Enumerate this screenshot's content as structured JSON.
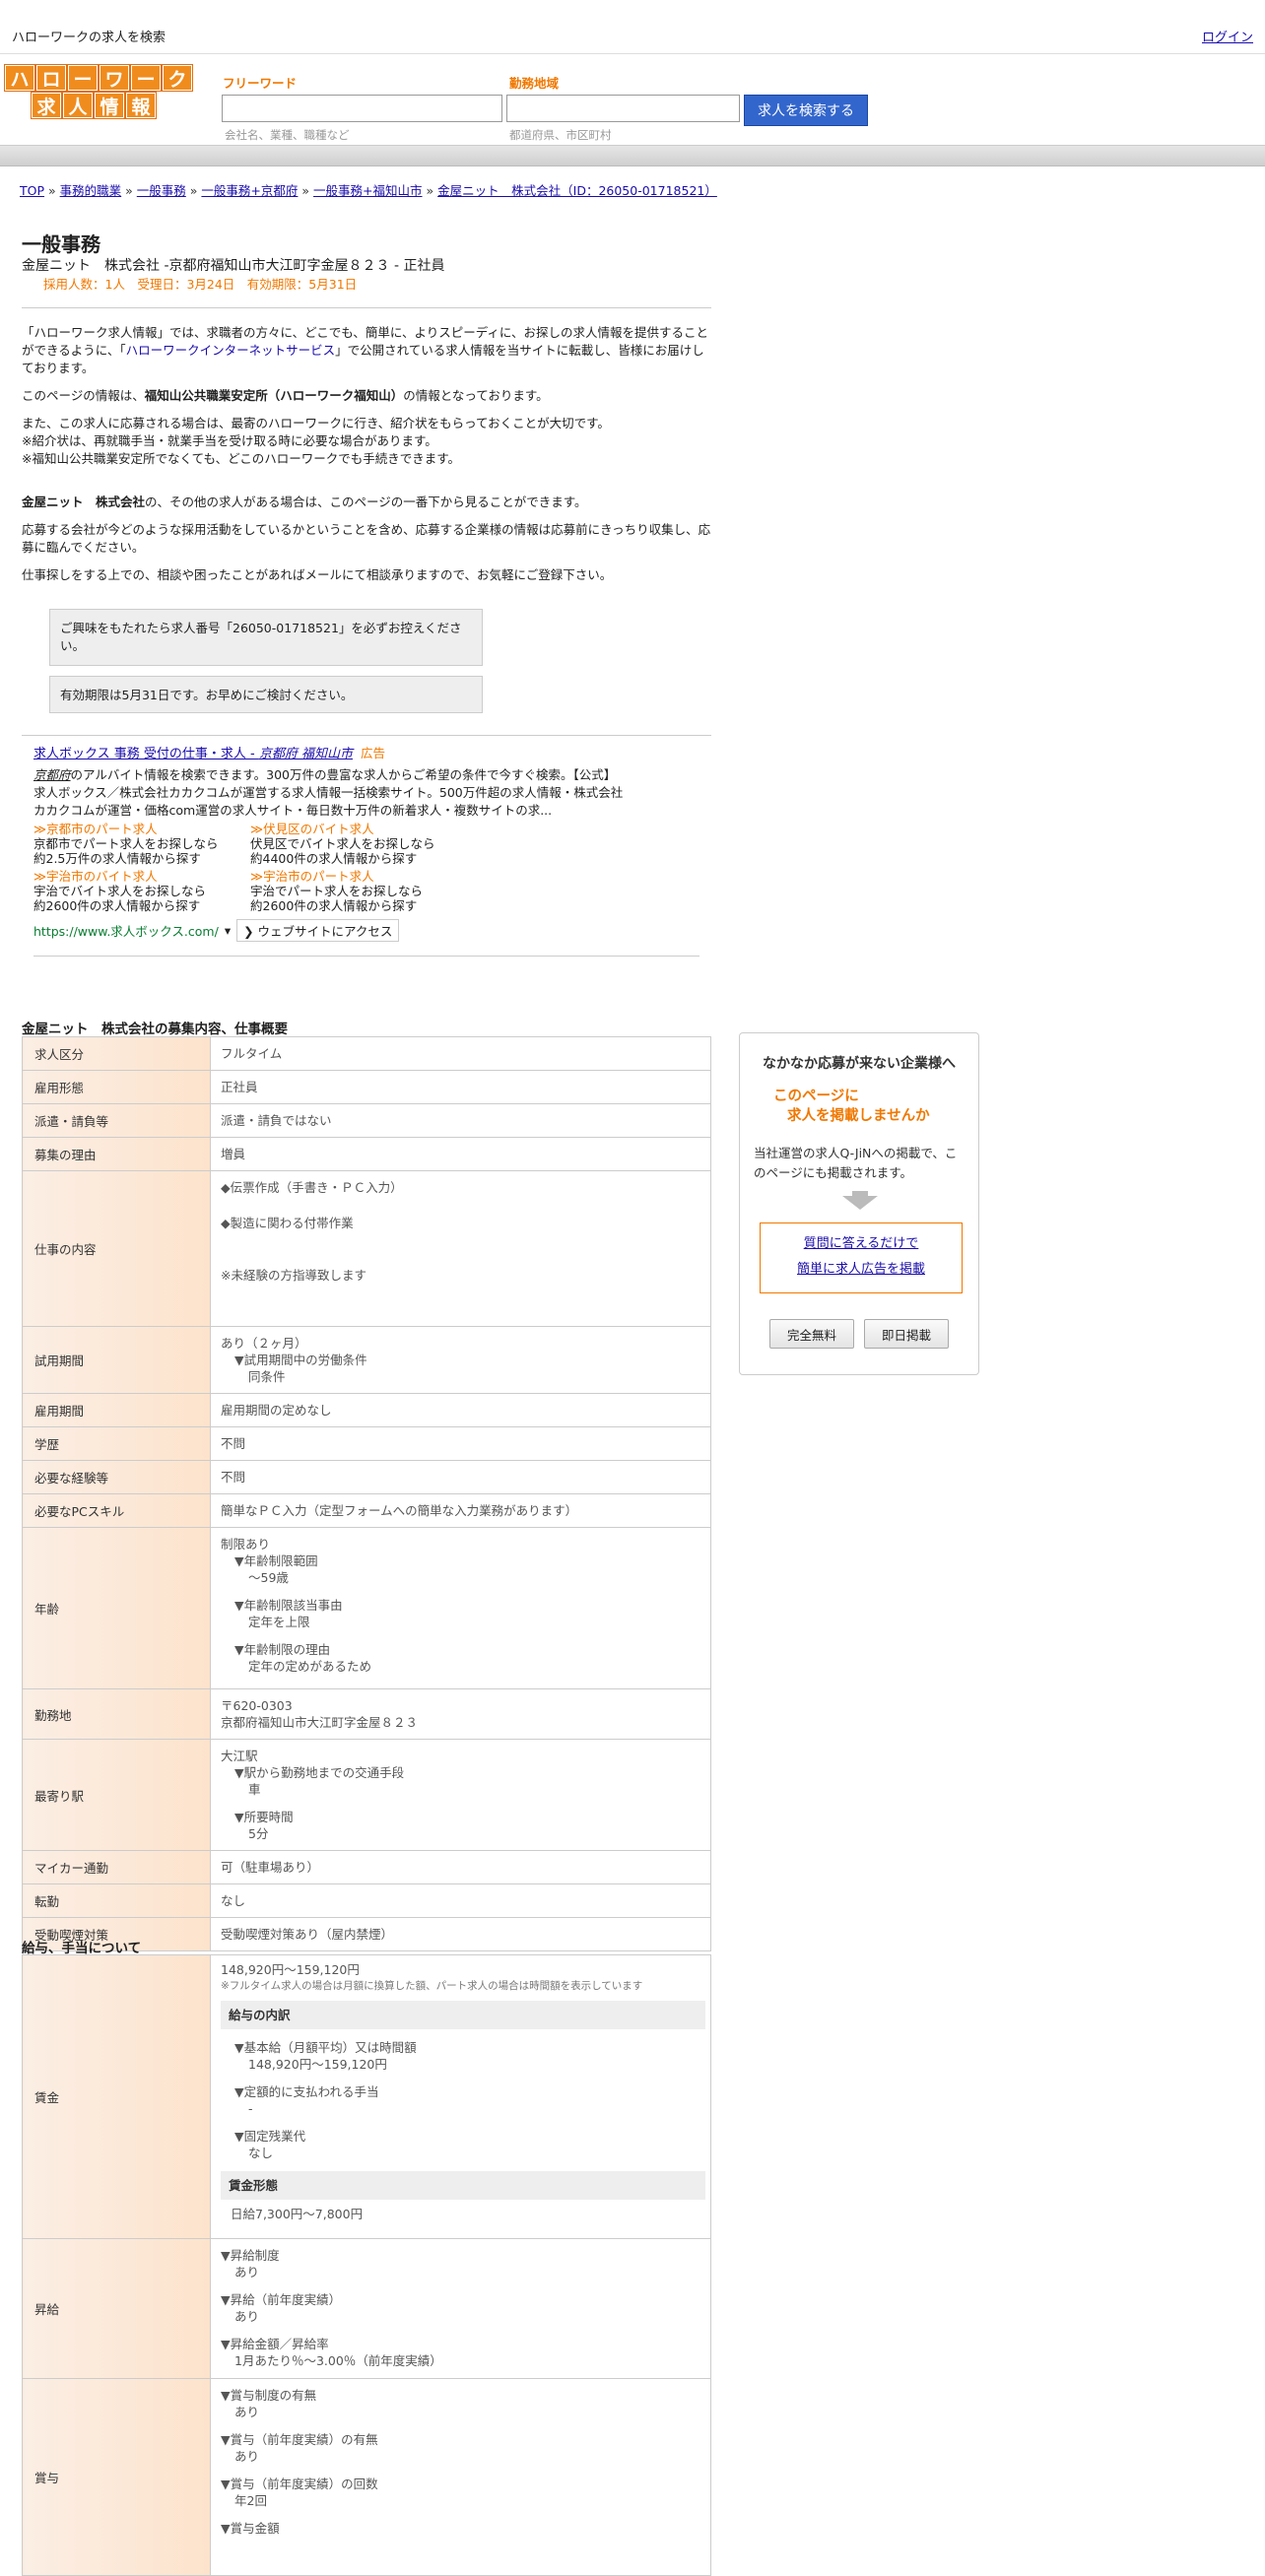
{
  "topbar": {
    "title": "ハローワークの求人を検索",
    "login": "ログイン"
  },
  "logo": {
    "row1": [
      "ハ",
      "ロ",
      "ー",
      "ワ",
      "ー",
      "ク"
    ],
    "row2": [
      "求",
      "人",
      "情",
      "報"
    ]
  },
  "search": {
    "keyword_label": "フリーワード",
    "keyword_placeholder": "会社名、業種、職種など",
    "area_label": "勤務地域",
    "area_placeholder": "都道府県、市区町村",
    "button": "求人を検索する"
  },
  "breadcrumb": [
    "TOP",
    "事務的職業",
    "一般事務",
    "一般事務+京都府",
    "一般事務+福知山市",
    "金屋ニット　株式会社（ID：26050-01718521）"
  ],
  "breadcrumb_sep": "»",
  "job": {
    "title": "一般事務",
    "subtitle": "金屋ニット　株式会社 -京都府福知山市大江町字金屋８２３ - 正社員",
    "meta": "採用人数：1人　受理日：3月24日　有効期限：5月31日"
  },
  "intro": {
    "p1_a": "「ハローワーク求人情報」では、求職者の方々に、どこでも、簡単に、よりスピーディに、お探しの求人情報を提供することができるように、「",
    "p1_link": "ハローワークインターネットサービス",
    "p1_b": "」で公開されている求人情報を当サイトに転載し、皆様にお届けしております。",
    "p2_a": "このページの情報は、",
    "p2_bold": "福知山公共職業安定所（ハローワーク福知山）",
    "p2_b": "の情報となっております。",
    "p3": "また、この求人に応募される場合は、最寄のハローワークに行き、紹介状をもらっておくことが大切です。",
    "p3b": "※紹介状は、再就職手当・就業手当を受け取る時に必要な場合があります。",
    "p3c": "※福知山公共職業安定所でなくても、どこのハローワークでも手続きできます。",
    "p4_bold": "金屋ニット　株式会社",
    "p4_b": "の、その他の求人がある場合は、このページの一番下から見ることができます。",
    "p5": "応募する会社が今どのような採用活動をしているかということを含め、応募する企業様の情報は応募前にきっちり収集し、応募に臨んでください。",
    "p6": "仕事探しをする上での、相談や困ったことがあればメールにて相談承りますので、お気軽にご登録下さい。"
  },
  "notes": [
    "ご興味をもたれたら求人番号「26050-01718521」を必ずお控えください。",
    "有効期限は5月31日です。お早めにご検討ください。"
  ],
  "ad": {
    "title_a": "求人ボックス 事務 受付の仕事・求人 - ",
    "title_b": "京都府 福知山市",
    "tag": "広告",
    "desc_a": "京都府",
    "desc_b": "のアルバイト情報を検索できます。300万件の豊富な求人からご希望の条件で今すぐ検索。【公式】求人ボックス／株式会社カカクコムが運営する求人情報一括検索サイト。500万件超の求人情報・株式会社カカクコムが運営・価格com運営の求人サイト・毎日数十万件の新着求人・複数サイトの求...",
    "sitelinks": [
      {
        "title": "≫京都市のパート求人",
        "l1": "京都市でパート求人をお探しなら",
        "l2": "約2.5万件の求人情報から探す"
      },
      {
        "title": "≫伏見区のバイト求人",
        "l1": "伏見区でバイト求人をお探しなら",
        "l2": "約4400件の求人情報から探す"
      },
      {
        "title": "≫宇治市のバイト求人",
        "l1": "宇治でバイト求人をお探しなら",
        "l2": "約2600件の求人情報から探す"
      },
      {
        "title": "≫宇治市のパート求人",
        "l1": "宇治でパート求人をお探しなら",
        "l2": "約2600件の求人情報から探す"
      }
    ],
    "url": "https://www.求人ボックス.com/",
    "dot": "▾",
    "visit": "❯ ウェブサイトにアクセス"
  },
  "section1": {
    "title": "金屋ニット　株式会社の募集内容、仕事概要",
    "rows": {
      "kubun": {
        "k": "求人区分",
        "v": "フルタイム"
      },
      "koyo": {
        "k": "雇用形態",
        "v": "正社員"
      },
      "haken": {
        "k": "派遣・請負等",
        "v": "派遣・請負ではない"
      },
      "riyu": {
        "k": "募集の理由",
        "v": "増員"
      },
      "naiyo": {
        "k": "仕事の内容",
        "v1": "◆伝票作成（手書き・ＰＣ入力）",
        "v2": "◆製造に関わる付帯作業",
        "v3": "※未経験の方指導致します"
      },
      "shiyo": {
        "k": "試用期間",
        "v1": "あり（２ヶ月）",
        "v2": "▼試用期間中の労働条件",
        "v3": "同条件"
      },
      "kikan": {
        "k": "雇用期間",
        "v": "雇用期間の定めなし"
      },
      "gakureki": {
        "k": "学歴",
        "v": "不問"
      },
      "keiken": {
        "k": "必要な経験等",
        "v": "不問"
      },
      "pc": {
        "k": "必要なPCスキル",
        "v": "簡単なＰＣ入力（定型フォームへの簡単な入力業務があります）"
      },
      "nenrei": {
        "k": "年齢",
        "v1": "制限あり",
        "v2": "▼年齢制限範囲",
        "v3": "〜59歳",
        "v4": "▼年齢制限該当事由",
        "v5": "定年を上限",
        "v6": "▼年齢制限の理由",
        "v7": "定年の定めがあるため"
      },
      "kinmu": {
        "k": "勤務地",
        "v1": "〒620-0303",
        "v2": "京都府福知山市大江町字金屋８２３"
      },
      "eki": {
        "k": "最寄り駅",
        "v1": "大江駅",
        "v2": "▼駅から勤務地までの交通手段",
        "v3": "車",
        "v4": "▼所要時間",
        "v5": "5分"
      },
      "mycar": {
        "k": "マイカー通勤",
        "v": "可（駐車場あり）"
      },
      "tenkin": {
        "k": "転勤",
        "v": "なし"
      },
      "kitsuen": {
        "k": "受動喫煙対策",
        "v": "受動喫煙対策あり（屋内禁煙）"
      }
    }
  },
  "section2": {
    "title": "給与、手当について",
    "chingin": {
      "k": "賃金",
      "v1": "148,920円〜159,120円",
      "v2": "※フルタイム求人の場合は月額に換算した額、パート求人の場合は時間額を表示しています",
      "h1": "給与の内訳",
      "a1": "▼基本給（月額平均）又は時間額",
      "a2": "148,920円〜159,120円",
      "a3": "▼定額的に支払われる手当",
      "a4": "-",
      "a5": "▼固定残業代",
      "a6": "なし",
      "h2": "賃金形態",
      "b1": "日給7,300円〜7,800円"
    },
    "shokyu": {
      "k": "昇給",
      "v1": "▼昇給制度",
      "v2": "あり",
      "v3": "▼昇給（前年度実績）",
      "v4": "あり",
      "v5": "▼昇給金額／昇給率",
      "v6": "1月あたり％〜3.00％（前年度実績）"
    },
    "shoyo": {
      "k": "賞与",
      "v1": "▼賞与制度の有無",
      "v2": "あり",
      "v3": "▼賞与（前年度実績）の有無",
      "v4": "あり",
      "v5": "▼賞与（前年度実績）の回数",
      "v6": "年2回",
      "v7": "▼賞与金額"
    }
  },
  "sidebox": {
    "heading": "なかなか応募が来ない企業様へ",
    "o1": "このページに",
    "o2": "求人を掲載しませんか",
    "desc": "当社運営の求人Q-JiNへの掲載で、このページにも掲載されます。",
    "link1": "質問に答えるだけで",
    "link2": "簡単に求人広告を掲載",
    "btn1": "完全無料",
    "btn2": "即日掲載"
  }
}
